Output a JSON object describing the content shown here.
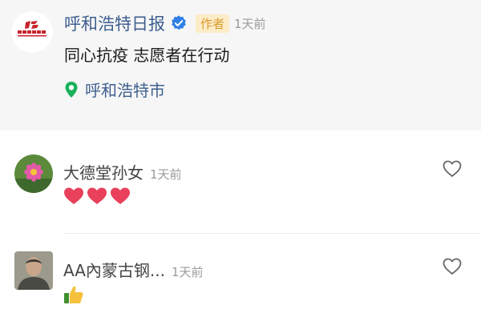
{
  "post": {
    "author": "呼和浩特日报",
    "author_badge": "作者",
    "time": "1天前",
    "content": "同心抗疫 志愿者在行动",
    "location": "呼和浩特市"
  },
  "comments": [
    {
      "user": "大德堂孙女",
      "time": "1天前",
      "emoji": [
        "heart",
        "heart",
        "heart"
      ]
    },
    {
      "user": "AA內蒙古钢...",
      "time": "1天前",
      "emoji": [
        "thumbs-up"
      ]
    }
  ],
  "colors": {
    "name_blue": "#3f5f8f",
    "verify_blue": "#2f7fe6",
    "badge_bg": "#fdecc8",
    "badge_text": "#d99a2b",
    "location_green": "#19b15c",
    "heart_red": "#e9405b"
  }
}
